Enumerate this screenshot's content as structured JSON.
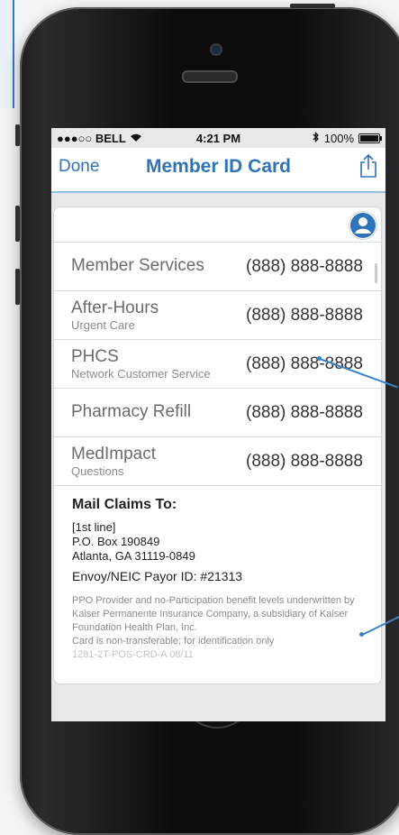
{
  "status_bar": {
    "carrier": "●●●○○ BELL",
    "time": "4:21 PM",
    "battery": "100%",
    "bluetooth_icon": "bluetooth-icon",
    "wifi_icon": "wifi-icon"
  },
  "nav": {
    "done_label": "Done",
    "title": "Member ID Card",
    "share_icon": "share-icon"
  },
  "contacts": [
    {
      "label": "Member Services",
      "sub": "",
      "phone": "(888) 888-8888"
    },
    {
      "label": "After-Hours",
      "sub": "Urgent Care",
      "phone": "(888) 888-8888"
    },
    {
      "label": "PHCS",
      "sub": "Network Customer Service",
      "phone": "(888) 888-8888"
    },
    {
      "label": "Pharmacy Refill",
      "sub": "",
      "phone": "(888) 888-8888"
    },
    {
      "label": "MedImpact",
      "sub": "Questions",
      "phone": "(888) 888-8888"
    }
  ],
  "mail": {
    "heading": "Mail Claims To:",
    "line1": "[1st line]",
    "line2": "P.O. Box 190849",
    "line3": "Atlanta, GA 31119-0849",
    "payor": "Envoy/NEIC Payor ID: #21313"
  },
  "fineprint": {
    "text1": "PPO Provider and no-Participation benefit levels underwritten by Kaiser Permanente Insurance Company, a subsidiary of Kaiser Foundation Health Plan, Inc.",
    "text2": "Card is non-transferable; for identification only",
    "text3": "1281-2T-POS-CRD-A 08/11"
  },
  "colors": {
    "accent": "#2f73b8",
    "annotation": "#3a83c8",
    "avatar": "#2f73b8"
  },
  "icons": [
    "user-avatar-icon",
    "share-icon",
    "wifi-icon",
    "bluetooth-icon",
    "battery-icon"
  ]
}
